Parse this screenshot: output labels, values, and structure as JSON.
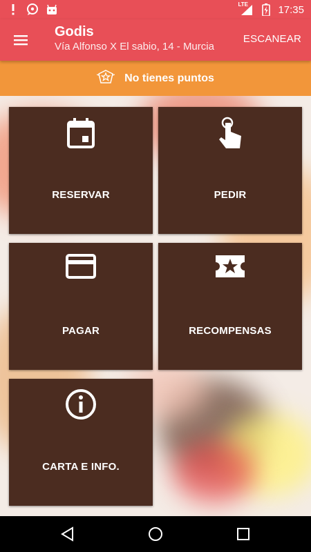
{
  "status_bar": {
    "time": "17:35",
    "network": "LTE",
    "icons": [
      "alert-icon",
      "chat-bubble-icon",
      "android-icon"
    ]
  },
  "app_bar": {
    "title": "Godis",
    "subtitle": "Vía Alfonso X El sabio, 14 - Murcia",
    "action_label": "ESCANEAR"
  },
  "points_banner": {
    "text": "No tienes puntos",
    "icon": "badge-icon"
  },
  "tiles": [
    {
      "label": "RESERVAR",
      "icon": "calendar-icon"
    },
    {
      "label": "PEDIR",
      "icon": "touch-icon"
    },
    {
      "label": "PAGAR",
      "icon": "credit-card-icon"
    },
    {
      "label": "RECOMPENSAS",
      "icon": "ticket-star-icon"
    },
    {
      "label": "CARTA E INFO.",
      "icon": "info-icon"
    }
  ],
  "colors": {
    "primary": "#e84f57",
    "banner": "#f2963a",
    "tile": "#4b2c20"
  }
}
